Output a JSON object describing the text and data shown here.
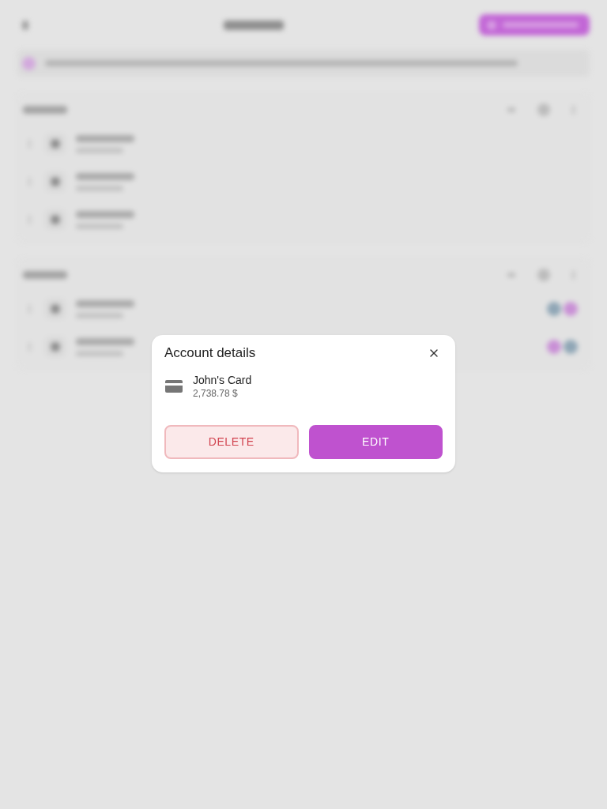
{
  "dialog": {
    "title": "Account details",
    "account": {
      "name": "John's Card",
      "balance": "2,738.78 $"
    },
    "buttons": [
      {
        "label": "DELETE",
        "kind": "danger"
      },
      {
        "label": "EDIT",
        "kind": "primary"
      }
    ]
  }
}
